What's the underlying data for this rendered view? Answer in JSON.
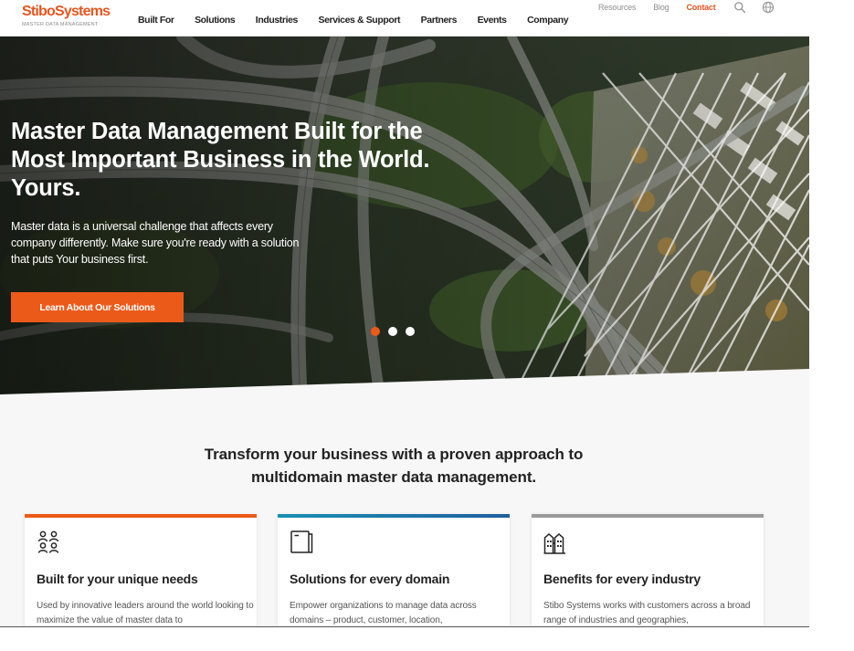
{
  "header": {
    "logo_main": "StiboSystems",
    "logo_sub": "Master Data Management",
    "nav": [
      "Built For",
      "Solutions",
      "Industries",
      "Services & Support",
      "Partners",
      "Events",
      "Company"
    ],
    "utility": {
      "resources": "Resources",
      "blog": "Blog",
      "contact": "Contact",
      "search_icon": "search-icon",
      "globe_icon": "globe-icon"
    }
  },
  "hero": {
    "title": "Master Data Management Built for the Most Important Business in the World. Yours.",
    "text": "Master data is a universal challenge that affects every company differently. Make sure you're ready with a solution that puts Your business first.",
    "cta_label": "Learn About Our Solutions",
    "slides": 3,
    "active_slide": 1
  },
  "content": {
    "heading_line1": "Transform your business with a proven approach to",
    "heading_line2": "multidomain master data management."
  },
  "cards": [
    {
      "title": "Built for your unique needs",
      "text": "Used by innovative leaders around the world looking to maximize the value of master data to",
      "icon": "people-icon",
      "accent": "#ec5a1a"
    },
    {
      "title": "Solutions for every domain",
      "text": "Empower organizations to manage data across domains – product, customer, location,",
      "icon": "folder-icon",
      "accent": "#1f5f9f"
    },
    {
      "title": "Benefits for every industry",
      "text": "Stibo Systems works with customers across a broad range of industries and geographies,",
      "icon": "buildings-icon",
      "accent": "#9a9a9a"
    }
  ],
  "colors": {
    "brand_orange": "#ec5a1a",
    "dark_text": "#222222",
    "nav_gray": "#8f8f8f"
  }
}
